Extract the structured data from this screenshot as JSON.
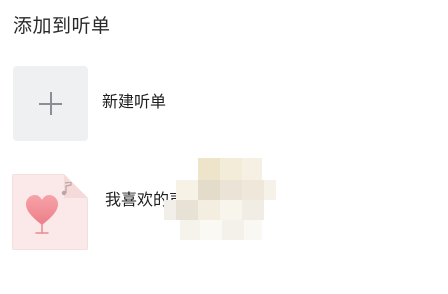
{
  "sheet": {
    "title": "添加到听单"
  },
  "items": [
    {
      "label": "新建听单",
      "icon": "plus-icon"
    },
    {
      "label": "我喜欢的声音",
      "icon": "heart-icon"
    }
  ],
  "colors": {
    "thumb_bg": "#eef0f2",
    "favorite_bg": "#fbe9e9",
    "heart": "#f08a92",
    "text": "#1f1f1f"
  }
}
